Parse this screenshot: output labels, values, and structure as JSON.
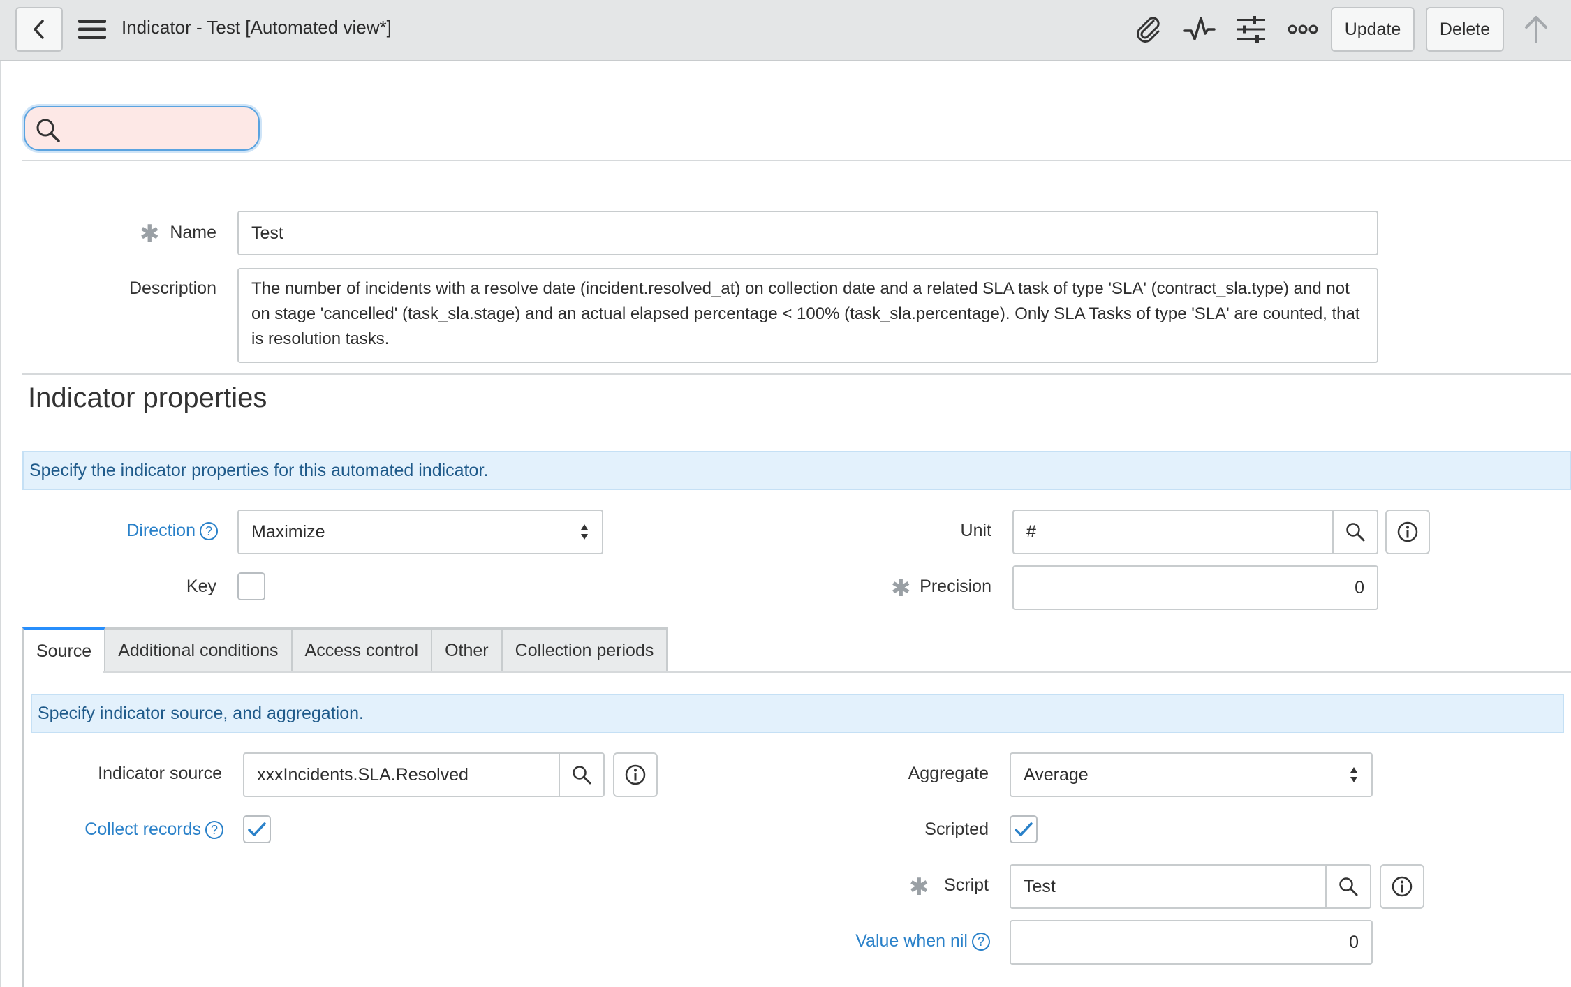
{
  "header": {
    "title": "Indicator - Test [Automated view*]",
    "update_label": "Update",
    "delete_label": "Delete"
  },
  "search": {
    "placeholder": ""
  },
  "form": {
    "name_label": "Name",
    "name_value": "Test",
    "description_label": "Description",
    "description_value": "The number of incidents with a resolve date (incident.resolved_at) on collection date and a related SLA task of type 'SLA' (contract_sla.type) and not on stage 'cancelled' (task_sla.stage) and an actual elapsed percentage < 100% (task_sla.percentage). Only SLA Tasks of type 'SLA' are counted, that is resolution tasks."
  },
  "properties": {
    "heading": "Indicator properties",
    "banner": "Specify the indicator properties for this automated indicator.",
    "direction_label": "Direction",
    "direction_value": "Maximize",
    "unit_label": "Unit",
    "unit_value": "#",
    "key_label": "Key",
    "precision_label": "Precision",
    "precision_value": "0"
  },
  "tabs": [
    {
      "label": "Source"
    },
    {
      "label": "Additional conditions"
    },
    {
      "label": "Access control"
    },
    {
      "label": "Other"
    },
    {
      "label": "Collection periods"
    }
  ],
  "source": {
    "banner": "Specify indicator source, and aggregation.",
    "indicator_source_label": "Indicator source",
    "indicator_source_value": "xxxIncidents.SLA.Resolved",
    "aggregate_label": "Aggregate",
    "aggregate_value": "Average",
    "collect_records_label": "Collect records",
    "collect_records_checked": true,
    "scripted_label": "Scripted",
    "scripted_checked": true,
    "script_label": "Script",
    "script_value": "Test",
    "value_when_nil_label": "Value when nil",
    "value_when_nil_value": "0"
  },
  "colors": {
    "link": "#2a81c9",
    "banner_bg": "#e3f1fc",
    "search_bg": "#fde8e6",
    "active_tab": "#278efc"
  }
}
